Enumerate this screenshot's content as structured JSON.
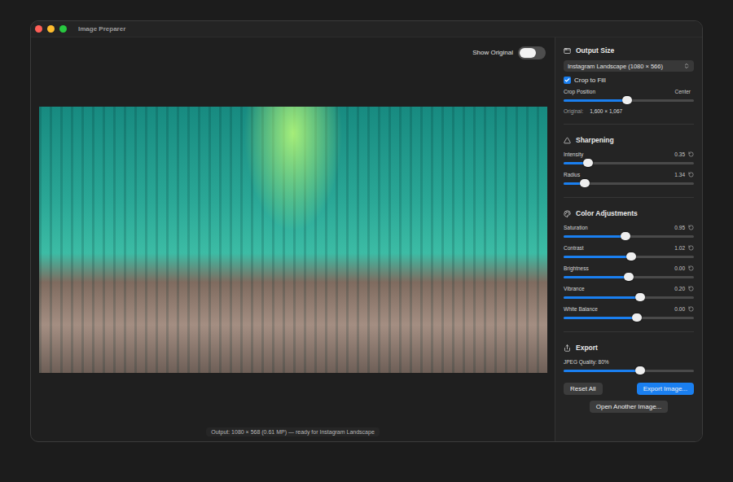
{
  "window": {
    "title": "Image Preparer"
  },
  "preview": {
    "toggle": {
      "label": "Show Original",
      "on": false
    },
    "status": "Output: 1080 × 568 (0.61 MP) — ready for Instagram Landscape"
  },
  "sections": [
    {
      "title": "Output Size",
      "controls": [
        {
          "kind": "select",
          "value": "Instagram Landscape (1080 × 566)"
        },
        {
          "kind": "checkbox",
          "label": "Crop to Fill",
          "checked": true
        },
        {
          "kind": "slider",
          "label": "Crop Position",
          "reading": "Center",
          "level": 0.49,
          "reset": false
        },
        {
          "kind": "info",
          "label": "Original:",
          "value": "1,600 × 1,067"
        }
      ]
    },
    {
      "title": "Sharpening",
      "controls": [
        {
          "kind": "slider",
          "label": "Intensity",
          "reading": "0.35",
          "level": 0.19,
          "reset": true
        },
        {
          "kind": "slider",
          "label": "Radius",
          "reading": "1.34",
          "level": 0.16,
          "reset": true
        }
      ]
    },
    {
      "title": "Color Adjustments",
      "controls": [
        {
          "kind": "slider",
          "label": "Saturation",
          "reading": "0.95",
          "level": 0.475,
          "reset": true
        },
        {
          "kind": "slider",
          "label": "Contrast",
          "reading": "1.02",
          "level": 0.52,
          "reset": true
        },
        {
          "kind": "slider",
          "label": "Brightness",
          "reading": "0.00",
          "level": 0.5,
          "reset": true
        },
        {
          "kind": "slider",
          "label": "Vibrance",
          "reading": "0.20",
          "level": 0.59,
          "reset": true
        },
        {
          "kind": "slider",
          "label": "White Balance",
          "reading": "0.00",
          "level": 0.56,
          "reset": true
        }
      ]
    },
    {
      "title": "Export",
      "controls": [
        {
          "kind": "slider",
          "label": "JPEG Quality: 80%",
          "level": 0.59,
          "reset": false
        },
        {
          "kind": "buttons",
          "buttons": [
            {
              "label": "Reset All",
              "primary": false
            },
            {
              "label": "Export Image...",
              "primary": true
            }
          ]
        },
        {
          "kind": "button",
          "label": "Open Another Image..."
        }
      ]
    }
  ]
}
